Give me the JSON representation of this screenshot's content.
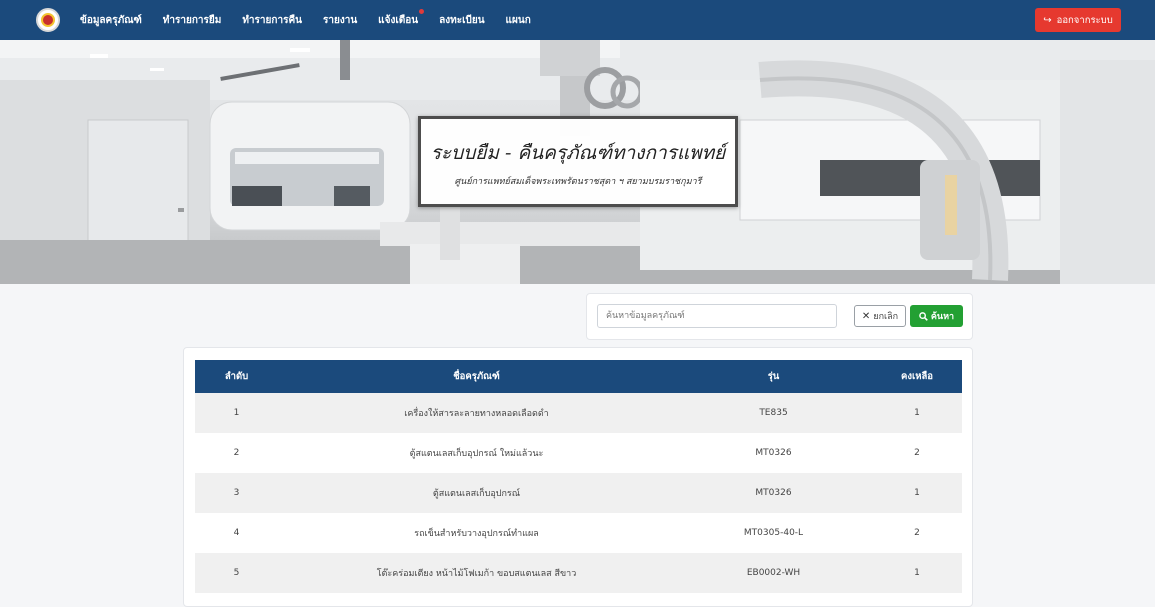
{
  "navbar": {
    "items": [
      {
        "label": "ข้อมูลครุภัณฑ์",
        "id": "equipment-data",
        "notify": false
      },
      {
        "label": "ทำรายการยืม",
        "id": "borrow",
        "notify": false
      },
      {
        "label": "ทำรายการคืน",
        "id": "return",
        "notify": false
      },
      {
        "label": "รายงาน",
        "id": "report",
        "notify": false
      },
      {
        "label": "แจ้งเตือน",
        "id": "notifications",
        "notify": true
      },
      {
        "label": "ลงทะเบียน",
        "id": "register",
        "notify": false
      },
      {
        "label": "แผนก",
        "id": "department",
        "notify": false
      }
    ],
    "logout_label": "ออกจากระบบ",
    "logout_icon": "sign-out-icon"
  },
  "hero": {
    "title": "ระบบยืม - คืนครุภัณฑ์ทางการแพทย์",
    "subtitle": "ศูนย์การแพทย์สมเด็จพระเทพรัตนราชสุดา ฯ สยามบรมราชกุมารี"
  },
  "search": {
    "placeholder": "ค้นหาข้อมูลครุภัณฑ์",
    "value": "",
    "cancel_label": "ยกเลิก",
    "search_label": "ค้นหา"
  },
  "table": {
    "headers": [
      "ลำดับ",
      "ชื่อครุภัณฑ์",
      "รุ่น",
      "คงเหลือ"
    ],
    "rows": [
      [
        "1",
        "เครื่องให้สารละลายทางหลอดเลือดดำ",
        "TE835",
        "1"
      ],
      [
        "2",
        "ตู้สแตนเลสเก็บอุปกรณ์ ใหม่แล้วนะ",
        "MT0326",
        "2"
      ],
      [
        "3",
        "ตู้สแตนเลสเก็บอุปกรณ์",
        "MT0326",
        "1"
      ],
      [
        "4",
        "รถเข็นสำหรับวางอุปกรณ์ทำแผล",
        "MT0305-40-L",
        "2"
      ],
      [
        "5",
        "โต๊ะคร่อมเตียง หน้าไม้โฟเมก้า ขอบสแตนเลส สีขาว",
        "EB0002-WH",
        "1"
      ]
    ]
  },
  "colors": {
    "navbar": "#1b4a7c",
    "logout": "#e6392f",
    "search_button": "#23a033",
    "table_header": "#1b4a7c"
  }
}
